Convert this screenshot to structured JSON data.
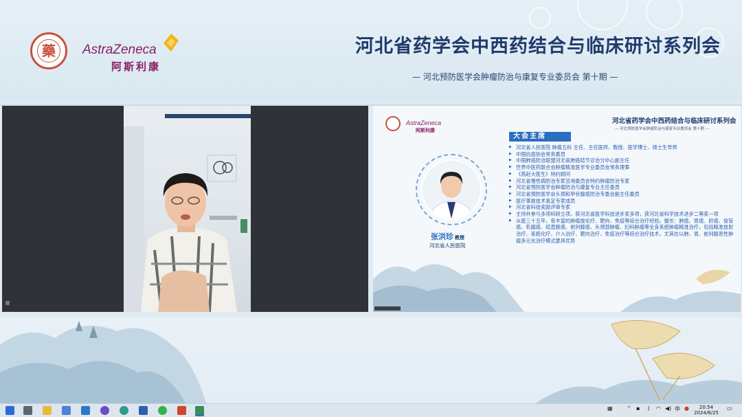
{
  "banner": {
    "logo_left_char": "藥",
    "brand_en": "AstraZeneca",
    "brand_zh": "阿斯利康",
    "title": "河北省药学会中西药结合与临床研讨系列会",
    "subtitle": "— 河北预防医学会肿瘤防治与康复专业委员会  第十期 —"
  },
  "slide": {
    "brand_en": "AstraZeneca",
    "brand_zh": "阿斯利康",
    "title": "河北省药学会中西药结合与临床研讨系列会",
    "subtitle": "— 河北预防医学会肿瘤防治与康复专业委员会  第十期 —",
    "section_tag": "大会主席",
    "doctor_name": "张洪珍",
    "doctor_title": "教授",
    "doctor_hospital": "河北省人民医院",
    "bullets": [
      "河北省人民医院 肿瘤五科 主任、主任医师、教授、医学博士、硕士生导师",
      "中国抗癌协会常务委员",
      "中国肺癌防治联盟河北省肺癌结节诊治分中心副主任",
      "世界中医药联合会肿瘤精准医学专业委员会常务理事",
      "《燕赵大医生》特约顾问",
      "河北省慢性病防治专家咨询委员会特约肿瘤防治专家",
      "河北省预防医学会肿瘤防治与康复专业主任委员",
      "河北省预防医学会头颈和甲状腺癌防治专委会副主任委员",
      "医疗事故技术鉴定专家成员",
      "河北省科技奖励评审专家",
      "主持并参与多项科研立项，获河北省医学科技进步奖多项，获河北省科学技术进步二等奖一项",
      "从医三十五年，有丰富的肿瘤放化疗、靶向、免疫等综合治疗经验。擅长：肺癌、胃癌、肝癌、食管癌、乳腺癌、结直肠癌、前列腺癌、头颈部肿瘤、妇科肿瘤等全身系统肿瘤精准治疗，包括精准放射治疗、系统化疗、介入治疗、靶向治疗、免疫治疗等综合治疗技术，尤其在以肺、胃、前列腺恶性肿瘤多元化治疗模式更具优势"
    ]
  },
  "taskbar": {
    "tray_lang": "中",
    "time": "20:54",
    "date": "2024/8/25",
    "icons": [
      "windows-start-icon",
      "task-view-icon",
      "file-explorer-icon",
      "store-icon",
      "mail-icon",
      "media-icon",
      "edge-icon",
      "word-icon",
      "wechat-icon",
      "powerpoint-icon",
      "meeting-app-icon"
    ]
  },
  "colors": {
    "title_blue": "#1f3b6b",
    "brand_purple": "#8a1e63",
    "accent_blue": "#2a6fc1",
    "seal_red": "#c8503a"
  }
}
